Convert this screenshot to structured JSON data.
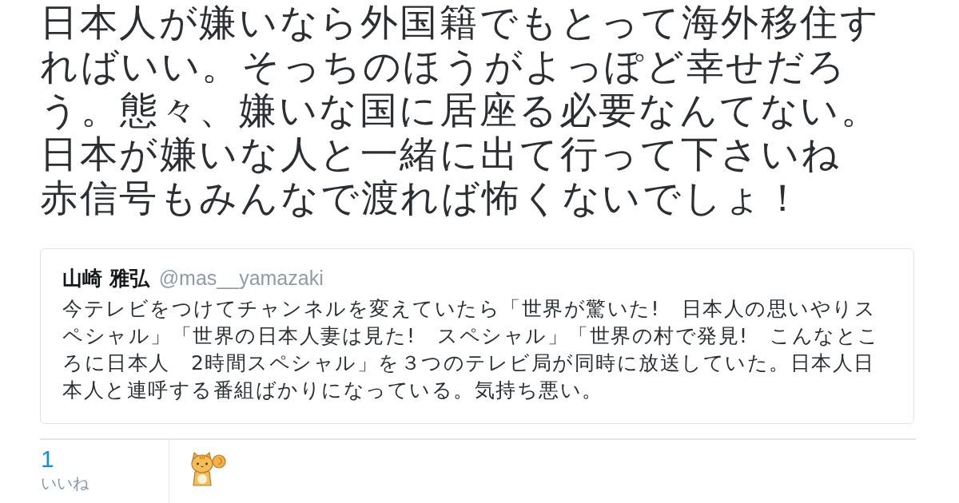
{
  "tweet": {
    "text_lines": [
      "日本人が嫌いなら外国籍でもとって海外移住す",
      "ればいい。そっちのほうがよっぽど幸せだろ",
      "う。態々、嫌いな国に居座る必要なんてない。",
      "日本が嫌いな人と一緒に出て行って下さいね",
      "赤信号もみんなで渡れば怖くないでしょ！"
    ]
  },
  "quoted_tweet": {
    "name": "山崎 雅弘",
    "handle": "@mas__yamazaki",
    "text_lines": [
      "今テレビをつけてチャンネルを変えていたら「世界が驚いた!　日本人の思いやりス",
      "ペシャル」「世界の日本人妻は見た!　スペシャル」「世界の村で発見!　こんなとこ",
      "ろに日本人　2時間スペシャル」を３つのテレビ局が同時に放送していた。日本人日",
      "本人と連呼する番組ばかりになっている。気持ち悪い。"
    ]
  },
  "stats": [
    {
      "count": "1",
      "label": "いいね"
    }
  ]
}
